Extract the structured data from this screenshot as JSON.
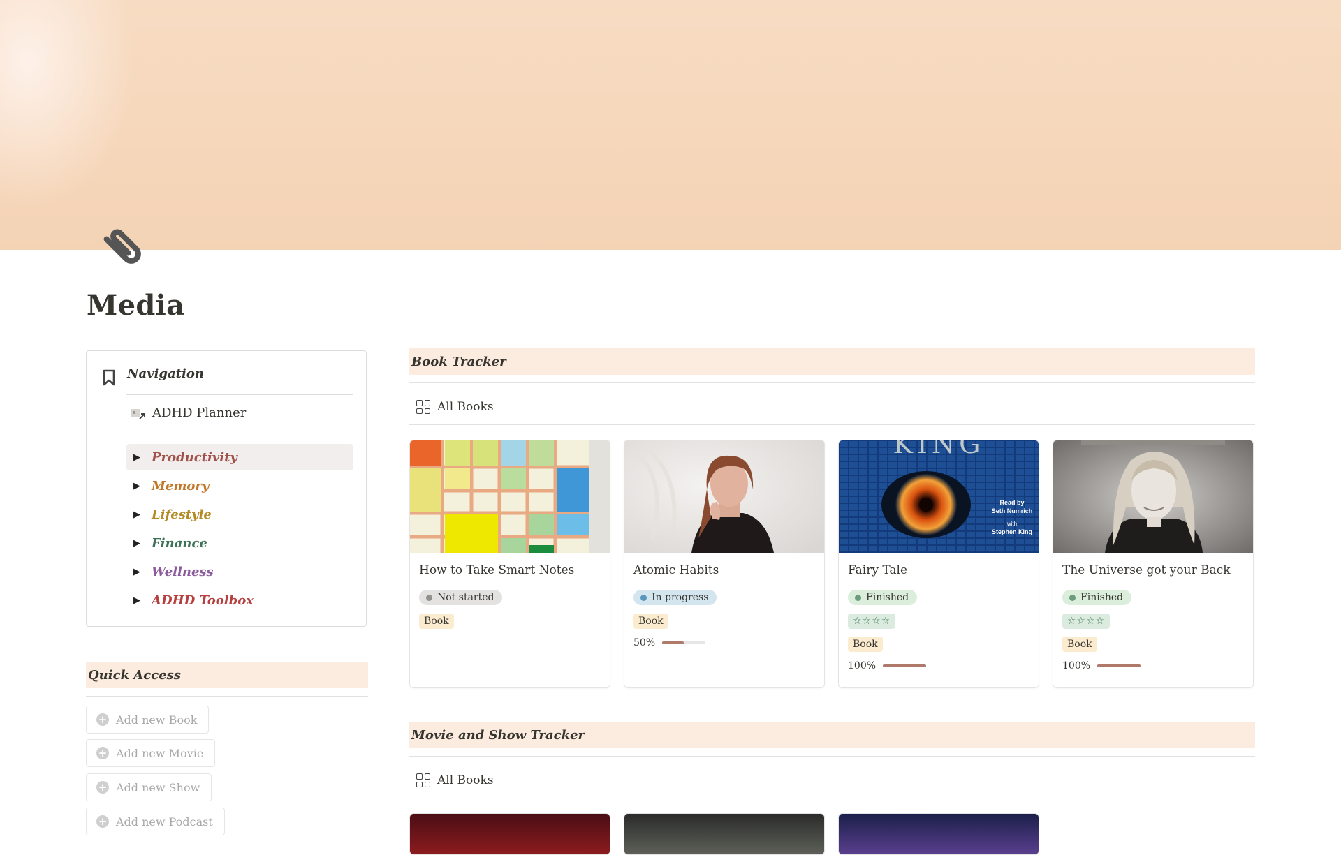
{
  "page": {
    "title": "Media",
    "icon": "paperclip-icon"
  },
  "navigation": {
    "title": "Navigation",
    "link": {
      "label": "ADHD Planner"
    },
    "toggles": [
      {
        "label": "Productivity",
        "color": "#a0524a",
        "active": true
      },
      {
        "label": "Memory",
        "color": "#c1782b"
      },
      {
        "label": "Lifestyle",
        "color": "#b38a26"
      },
      {
        "label": "Finance",
        "color": "#3f7257"
      },
      {
        "label": "Wellness",
        "color": "#8a5a9c"
      },
      {
        "label": "ADHD Toolbox",
        "color": "#b4403f"
      }
    ]
  },
  "quick_access": {
    "title": "Quick Access",
    "buttons": [
      "Add new Book",
      "Add new Movie",
      "Add new Show",
      "Add new Podcast"
    ]
  },
  "book_tracker": {
    "title": "Book Tracker",
    "view": "All Books",
    "cards": [
      {
        "title": "How to Take Smart Notes",
        "status": "Not started",
        "status_bg": "#e3e2e0",
        "status_dot": "#91918e",
        "type": "Book"
      },
      {
        "title": "Atomic Habits",
        "status": "In progress",
        "status_bg": "#d3e5ef",
        "status_dot": "#5b97bd",
        "type": "Book",
        "progress": "50%",
        "progress_value": 0.5
      },
      {
        "title": "Fairy Tale",
        "status": "Finished",
        "status_bg": "#dbeddb",
        "status_dot": "#6c9b7d",
        "rating": "☆☆☆☆",
        "type": "Book",
        "progress": "100%",
        "progress_value": 1.0,
        "cover_text": {
          "top": "KING",
          "read_by": "Read by",
          "reader": "Seth Numrich",
          "with": "with",
          "coauthor": "Stephen King"
        }
      },
      {
        "title": "The Universe got your Back",
        "status": "Finished",
        "status_bg": "#dbeddb",
        "status_dot": "#6c9b7d",
        "rating": "☆☆☆☆",
        "type": "Book",
        "progress": "100%",
        "progress_value": 1.0
      }
    ]
  },
  "movie_tracker": {
    "title": "Movie and Show Tracker",
    "view": "All Books"
  }
}
